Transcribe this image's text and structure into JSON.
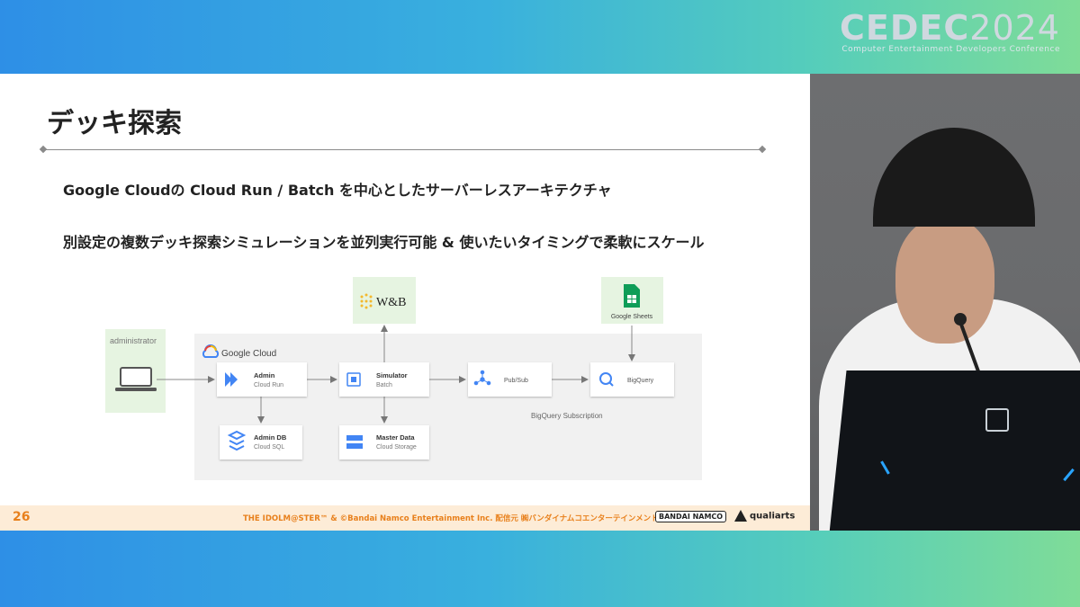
{
  "event": {
    "logo_main": "CEDEC",
    "logo_year": "2024",
    "logo_sub": "Computer Entertainment Developers Conference"
  },
  "slide": {
    "title": "デッキ探索",
    "bullets": [
      "Google Cloudの Cloud Run / Batch を中心としたサーバーレスアーキテクチャ",
      "別設定の複数デッキ探索シミュレーションを並列実行可能 & 使いたいタイミングで柔軟にスケール"
    ],
    "page_number": "26",
    "copyright": "THE IDOLM@STER™ & ©Bandai Namco Entertainment Inc.  配信元 ㈱バンダイナムコエンターテインメント",
    "brand1": "BANDAI NAMCO",
    "brand2": "qualiarts"
  },
  "diagram": {
    "admin_group_label": "administrator",
    "cloud_group_label": "Google Cloud",
    "nodes": {
      "admin": {
        "title": "Admin",
        "subtitle": "Cloud Run"
      },
      "simulator": {
        "title": "Simulator",
        "subtitle": "Batch"
      },
      "pubsub": {
        "title": "Pub/Sub"
      },
      "bigquery": {
        "title": "BigQuery"
      },
      "admindb": {
        "title": "Admin DB",
        "subtitle": "Cloud SQL"
      },
      "masterdata": {
        "title": "Master Data",
        "subtitle": "Cloud Storage"
      },
      "wandb": {
        "title": "W&B"
      },
      "sheets": {
        "title": "Google Sheets"
      }
    },
    "subscription_label": "BigQuery Subscription",
    "colors": {
      "accent": "#4285f4",
      "group_bg": "#f1f1f1",
      "green_bg": "#e6f4e1",
      "footer_orange": "#e8801c"
    }
  }
}
